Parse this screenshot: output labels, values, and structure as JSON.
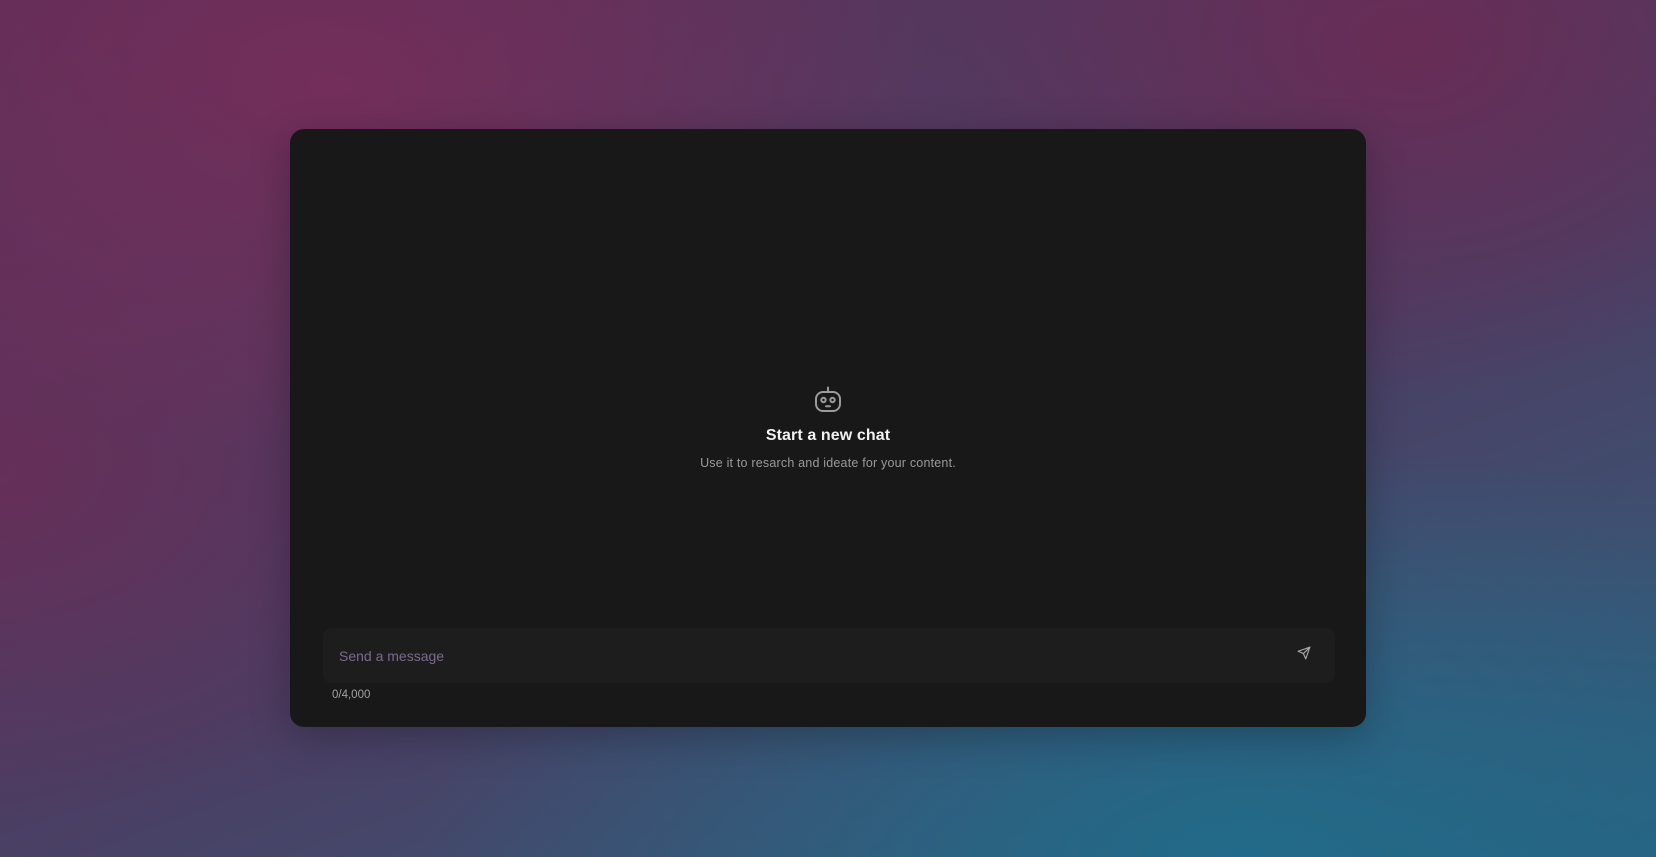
{
  "empty_state": {
    "icon": "robot-icon",
    "title": "Start a new chat",
    "subtitle": "Use it to resarch and ideate for your content."
  },
  "composer": {
    "placeholder": "Send a message",
    "value": "",
    "send_icon": "send-icon",
    "char_count": "0/4,000"
  },
  "colors": {
    "card_background": "#181818",
    "input_background": "#1d1d1d",
    "placeholder": "#7b6b8e"
  }
}
